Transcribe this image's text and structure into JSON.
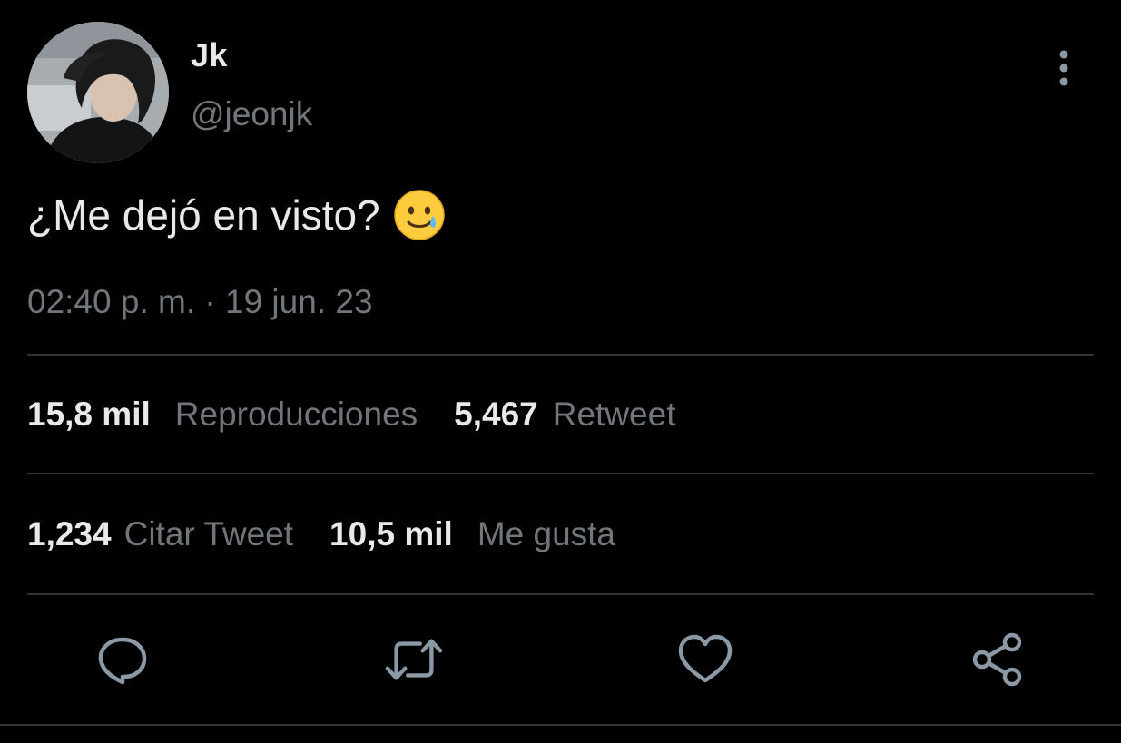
{
  "author": {
    "display_name": "Jk",
    "handle": "@jeonjk"
  },
  "tweet": {
    "text": "¿Me dejó en visto?",
    "emoji_icon": "smiling-face-with-tear-icon",
    "time": "02:40 p. m.",
    "separator": " · ",
    "date": "19 jun. 23"
  },
  "stats": {
    "views": {
      "value": "15,8 mil",
      "label": "Reproducciones"
    },
    "retweets": {
      "value": "5,467",
      "label": "Retweet"
    },
    "quotes": {
      "value": "1,234",
      "label": "Citar Tweet"
    },
    "likes": {
      "value": "10,5 mil",
      "label": "Me gusta"
    }
  },
  "actions": [
    {
      "icon": "reply-icon"
    },
    {
      "icon": "retweet-icon"
    },
    {
      "icon": "like-icon"
    },
    {
      "icon": "share-icon"
    }
  ],
  "colors": {
    "background": "#000000",
    "primary_text": "#e7e9ea",
    "secondary_text": "#71767b",
    "divider": "#2f3336",
    "icon": "#8b98a5"
  }
}
